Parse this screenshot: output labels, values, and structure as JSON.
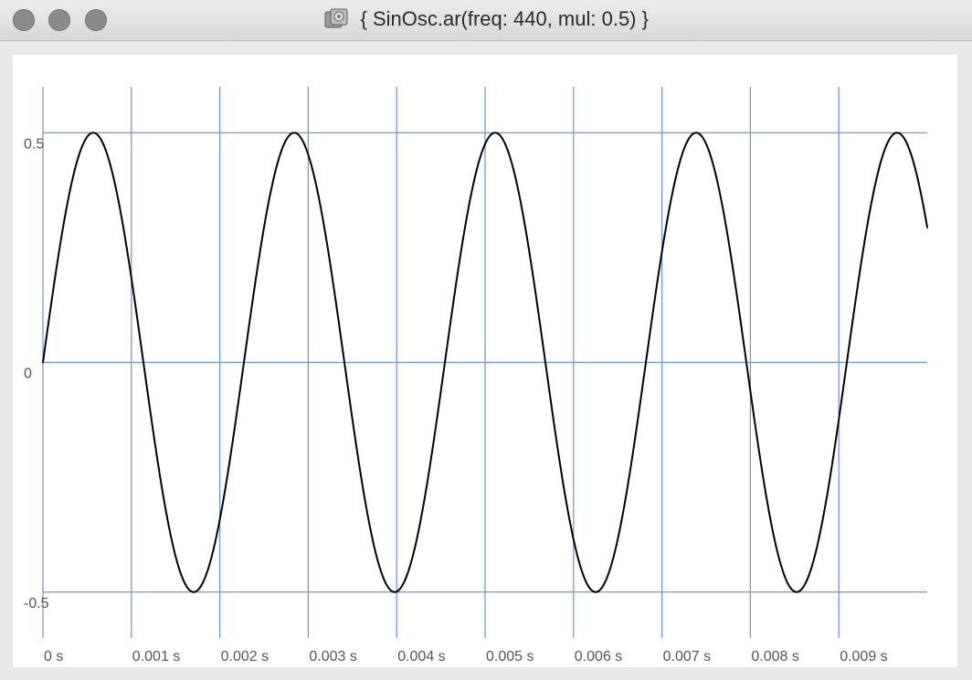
{
  "window": {
    "title": "{ SinOsc.ar(freq: 440, mul: 0.5) }",
    "icon": "document-icon"
  },
  "chart_data": {
    "type": "line",
    "title": "",
    "xlabel": "",
    "ylabel": "",
    "xlim": [
      0,
      0.01
    ],
    "ylim": [
      -0.6,
      0.6
    ],
    "grid": true,
    "y_ticks": [
      {
        "value": 0.5,
        "label": "0.5"
      },
      {
        "value": 0,
        "label": "0"
      },
      {
        "value": -0.5,
        "label": "-0.5"
      }
    ],
    "x_ticks": [
      {
        "value": 0,
        "label": "0 s"
      },
      {
        "value": 0.001,
        "label": "0.001 s"
      },
      {
        "value": 0.002,
        "label": "0.002 s"
      },
      {
        "value": 0.003,
        "label": "0.003 s"
      },
      {
        "value": 0.004,
        "label": "0.004 s"
      },
      {
        "value": 0.005,
        "label": "0.005 s"
      },
      {
        "value": 0.006,
        "label": "0.006 s"
      },
      {
        "value": 0.007,
        "label": "0.007 s"
      },
      {
        "value": 0.008,
        "label": "0.008 s"
      },
      {
        "value": 0.009,
        "label": "0.009 s"
      }
    ],
    "series": [
      {
        "function": "sine",
        "frequency": 440,
        "amplitude": 0.5,
        "x_start": 0,
        "x_end": 0.01
      }
    ],
    "colors": {
      "grid": "#6b93d6",
      "line": "#000000"
    }
  }
}
